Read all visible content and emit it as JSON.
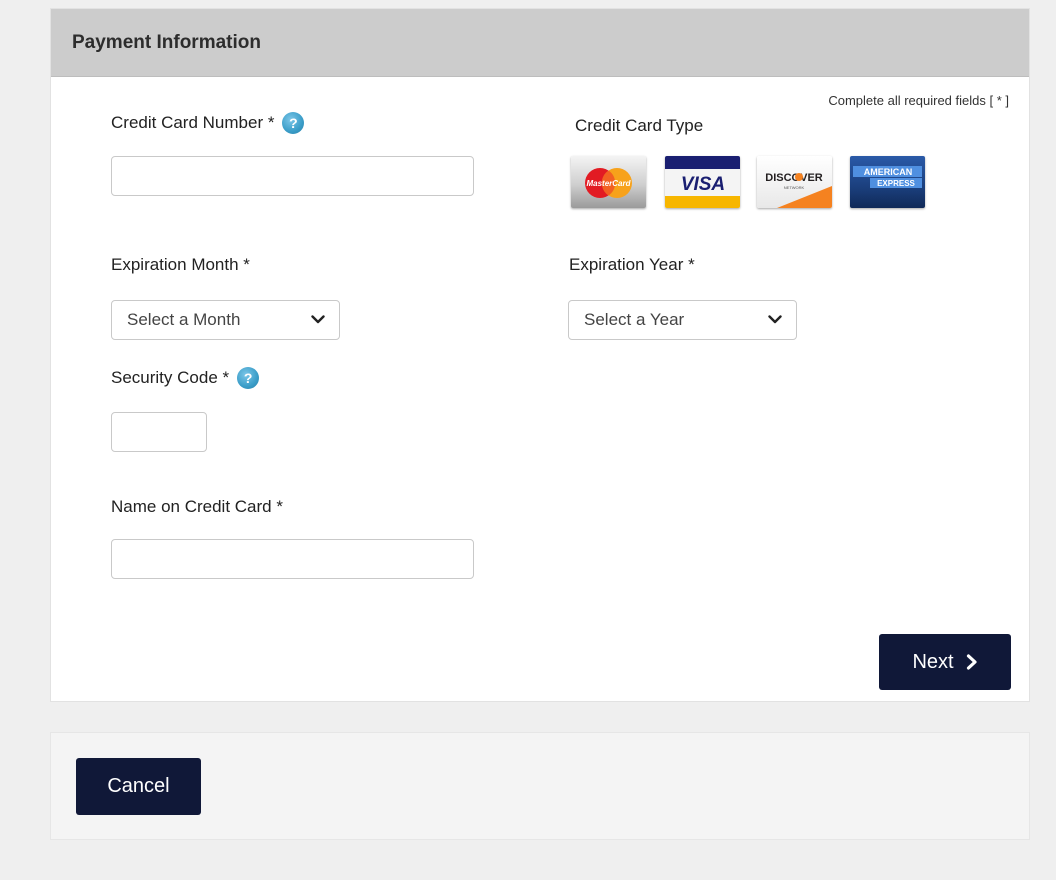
{
  "panel": {
    "title": "Payment Information",
    "required_note": "Complete all required fields [ * ]"
  },
  "fields": {
    "card_number": {
      "label": "Credit Card Number *",
      "value": "",
      "placeholder": ""
    },
    "card_type": {
      "label": "Credit Card Type"
    },
    "exp_month": {
      "label": "Expiration Month *",
      "selected": "Select a Month"
    },
    "exp_year": {
      "label": "Expiration Year *",
      "selected": "Select a Year"
    },
    "security_code": {
      "label": "Security Code *",
      "value": ""
    },
    "name_on_card": {
      "label": "Name on Credit Card *",
      "value": ""
    }
  },
  "help_icon": {
    "glyph": "?",
    "icon": "help-icon",
    "color": "#3a9dc8"
  },
  "card_logos": {
    "mastercard": {
      "text": "MasterCard"
    },
    "visa": {
      "text": "VISA"
    },
    "discover": {
      "text": "DISCOVER",
      "subtext": "NETWORK"
    },
    "amex": {
      "line1": "AMERICAN",
      "line2": "EXPRESS"
    }
  },
  "buttons": {
    "next": {
      "label": "Next",
      "icon": "chevron-right-icon",
      "color": "#101838"
    },
    "cancel": {
      "label": "Cancel",
      "color": "#101838"
    }
  }
}
